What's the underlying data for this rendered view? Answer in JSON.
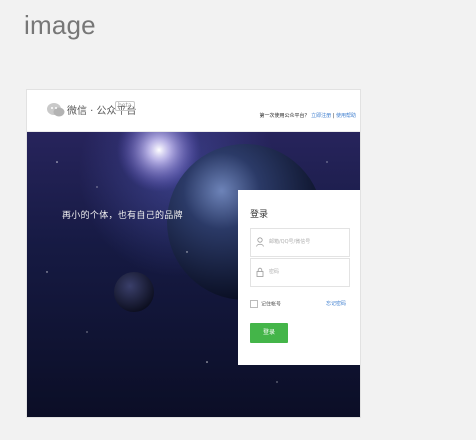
{
  "caption": "image",
  "header": {
    "brand": "微信 · 公众平台",
    "badge": "beta",
    "intro_text": "第一次使用公众平台？",
    "link_signup": "立即注册",
    "separator": "|",
    "link_help": "使用帮助"
  },
  "hero": {
    "slogan": "再小的个体，也有自己的品牌"
  },
  "login": {
    "title": "登录",
    "account_placeholder": "邮箱/QQ号/微信号",
    "password_placeholder": "密码",
    "remember_label": "记住帐号",
    "forgot_label": "忘记密码",
    "button_label": "登录"
  },
  "colors": {
    "accent_green": "#44b549",
    "link_blue": "#3e7ecf"
  },
  "icons": [
    "wechat-logo-icon",
    "user-icon",
    "lock-icon",
    "checkbox"
  ]
}
